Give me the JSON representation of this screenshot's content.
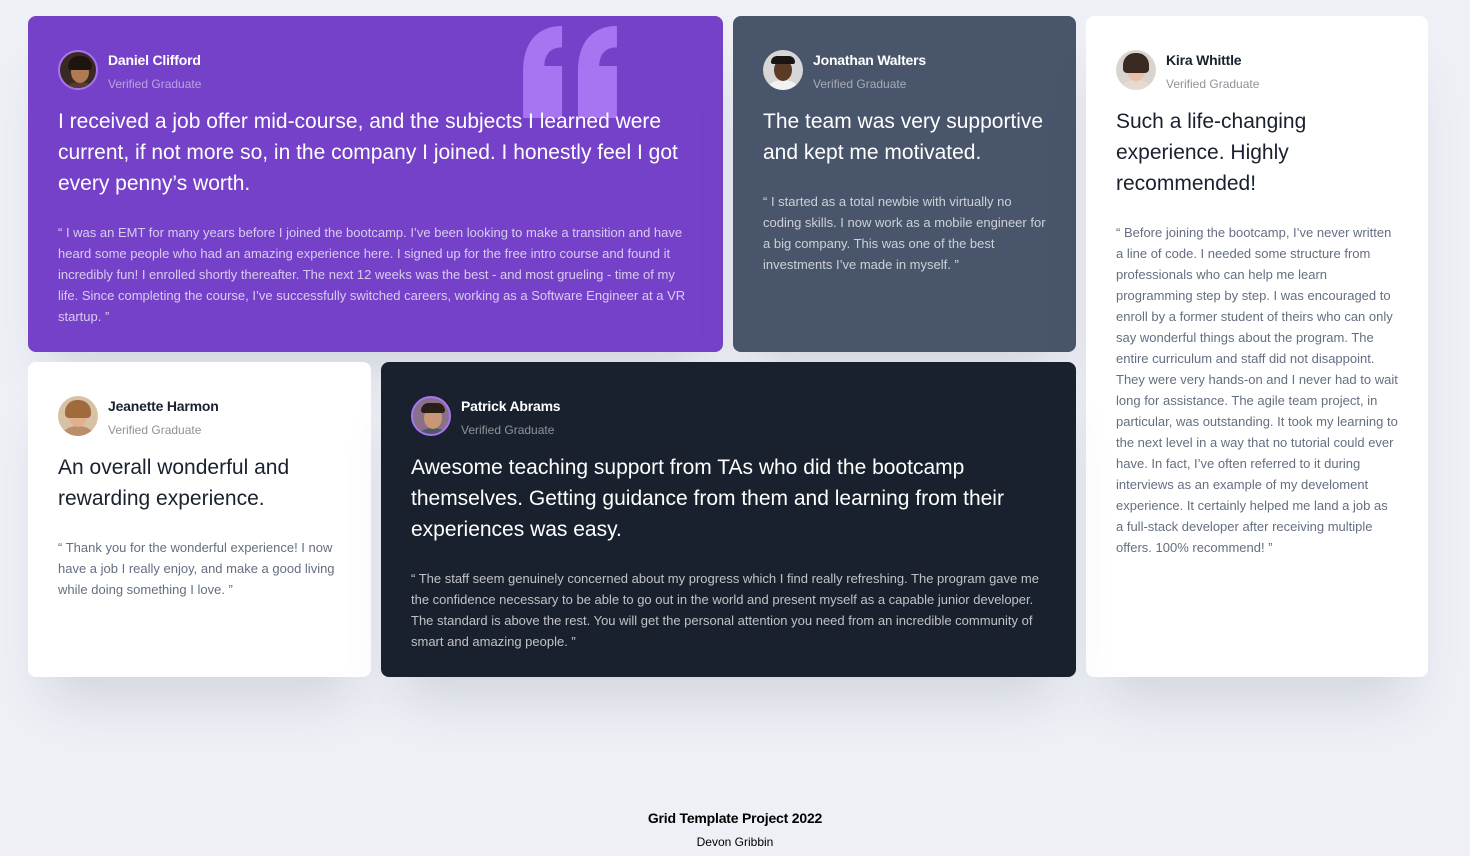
{
  "testimonials": [
    {
      "name": "Daniel Clifford",
      "role": "Verified Graduate",
      "headline": "I received a job offer mid-course, and the subjects I learned were current, if not more so, in the company I joined. I honestly feel I got every penny’s worth.",
      "quote": "“ I was an EMT for many years before I joined the bootcamp. I’ve been looking to make a transition and have heard some people who had an amazing experience here. I signed up for the free intro course and found it incredibly fun! I enrolled shortly thereafter. The next 12 weeks was the best - and most grueling - time of my life. Since completing the course, I’ve successfully switched careers, working as a Software Engineer at a VR startup. ”",
      "background": "#7541c8"
    },
    {
      "name": "Jonathan Walters",
      "role": "Verified Graduate",
      "headline": "The team was very supportive and kept me motivated.",
      "quote": "“ I started as a total newbie with virtually no coding skills. I now work as a mobile engineer for a big company. This was one of the best investments I’ve made in myself. ”",
      "background": "#48556a"
    },
    {
      "name": "Kira Whittle",
      "role": "Verified Graduate",
      "headline": "Such a life-changing experience. Highly recommended!",
      "quote": "“ Before joining the bootcamp, I’ve never written a line of code. I needed some structure from professionals who can help me learn programming step by step. I was encouraged to enroll by a former student of theirs who can only say wonderful things about the program. The entire curriculum and staff did not disappoint. They were very hands-on and I never had to wait long for assistance. The agile team project, in particular, was outstanding. It took my learning to the next level in a way that no tutorial could ever have. In fact, I’ve often referred to it during interviews as an example of my develoment experience. It certainly helped me land a job as a full-stack developer after receiving multiple offers. 100% recommend! ”",
      "background": "#ffffff"
    },
    {
      "name": "Jeanette Harmon",
      "role": "Verified Graduate",
      "headline": "An overall wonderful and rewarding experience.",
      "quote": "“ Thank you for the wonderful experience! I now have a job I really enjoy, and make a good living while doing something I love. ”",
      "background": "#ffffff"
    },
    {
      "name": "Patrick Abrams",
      "role": "Verified Graduate",
      "headline": "Awesome teaching support from TAs who did the bootcamp themselves. Getting guidance from them and learning from their experiences was easy.",
      "quote": "“ The staff seem genuinely concerned about my progress which I find really refreshing. The program gave me the confidence necessary to be able to go out in the world and present myself as a capable junior developer. The standard is above the rest. You will get the personal attention you need from an incredible community of smart and amazing people. ”",
      "background": "#19212e"
    }
  ],
  "footer": {
    "title": "Grid Template Project 2022",
    "author": "Devon Gribbin"
  },
  "icons": {
    "quote": "quotation-mark-icon"
  },
  "colors": {
    "page_background": "#eef0f6",
    "moderate_violet": "#7541c8",
    "light_violet": "#a775f1",
    "grayish_blue": "#48556a",
    "very_dark_blackish_blue": "#19212e"
  }
}
